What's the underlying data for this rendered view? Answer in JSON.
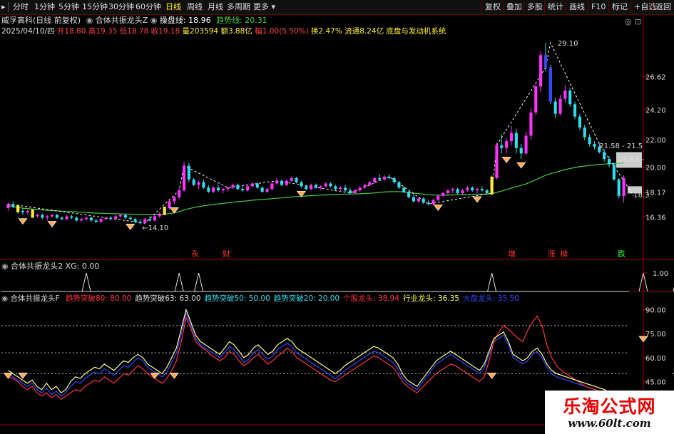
{
  "toolbar": {
    "tabs": [
      {
        "label": "分时",
        "active": false
      },
      {
        "label": "1分钟",
        "active": false
      },
      {
        "label": "5分钟",
        "active": false
      },
      {
        "label": "15分钟",
        "active": false
      },
      {
        "label": "30分钟",
        "active": false
      },
      {
        "label": "60分钟",
        "active": false
      },
      {
        "label": "日线",
        "active": true
      },
      {
        "label": "周线",
        "active": false
      },
      {
        "label": "月线",
        "active": false
      },
      {
        "label": "多周期",
        "active": false
      },
      {
        "label": "更多",
        "active": false
      }
    ],
    "right_buttons": [
      "复权",
      "叠加",
      "多股",
      "统计",
      "画线",
      "F10",
      "标记",
      "+自选",
      "返回"
    ]
  },
  "header": {
    "stock_title": "威孚高科(日线 前复权)",
    "indicator_name": "合体共振龙头Z",
    "caoban_label": "操盘线:",
    "caoban_value": "18.96",
    "trend_label": "趋势线:",
    "trend_value": "20.31",
    "quote": {
      "date": "2025/04/10/四",
      "open_label": "开",
      "open": "18.80",
      "high_label": "高",
      "high": "19.35",
      "low_label": "低",
      "low": "18.78",
      "close_label": "收",
      "close": "19.18",
      "vol_label": "量",
      "vol": "203594",
      "amount_label": "额",
      "amount": "3.88亿",
      "change_label": "幅",
      "change": "1.00(5.50%)",
      "turnover_label": "换",
      "turnover": "2.47%",
      "float_label": "流通",
      "float": "8.24亿",
      "sector": "底盘与发动机系统"
    }
  },
  "main_chart": {
    "price_axis": [
      "26.62",
      "24.20",
      "22.00",
      "20.00",
      "18.17",
      "16.36"
    ],
    "peak_label": "29.10",
    "low_label": "14.10",
    "right_labels": [
      "21.58 - 21.5",
      "20.58 -",
      "18.3"
    ],
    "bottom_tags": [
      {
        "text": "永",
        "color": "#ff3333"
      },
      {
        "text": "财",
        "color": "#ff3333"
      },
      {
        "text": "增",
        "color": "#ff3333"
      },
      {
        "text": "涨",
        "color": "#ff3333"
      },
      {
        "text": "榜",
        "color": "#ff3333"
      },
      {
        "text": "跌",
        "color": "#33ff33"
      }
    ],
    "colors": {
      "up": "#ff33ff",
      "down": "#33ddee",
      "ma": "#44cc44",
      "bg": "#000000",
      "grid": "#880000"
    },
    "candles": [
      [
        17.0,
        17.4,
        16.8,
        17.3
      ],
      [
        17.3,
        17.5,
        17.0,
        17.1
      ],
      [
        17.1,
        17.3,
        16.6,
        16.8
      ],
      [
        16.8,
        17.0,
        16.5,
        16.7
      ],
      [
        16.7,
        16.9,
        16.5,
        16.8
      ],
      [
        16.8,
        16.9,
        16.3,
        16.4
      ],
      [
        16.4,
        16.6,
        16.3,
        16.5
      ],
      [
        16.5,
        16.6,
        16.2,
        16.3
      ],
      [
        16.3,
        16.5,
        16.1,
        16.4
      ],
      [
        16.4,
        16.6,
        16.3,
        16.5
      ],
      [
        16.5,
        16.6,
        16.2,
        16.3
      ],
      [
        16.3,
        16.4,
        16.1,
        16.2
      ],
      [
        16.2,
        16.5,
        16.1,
        16.4
      ],
      [
        16.4,
        16.5,
        16.2,
        16.3
      ],
      [
        16.3,
        16.4,
        16.0,
        16.1
      ],
      [
        16.1,
        16.3,
        16.0,
        16.2
      ],
      [
        16.2,
        16.4,
        16.1,
        16.3
      ],
      [
        16.3,
        16.4,
        16.0,
        16.1
      ],
      [
        16.1,
        16.2,
        15.9,
        16.0
      ],
      [
        16.0,
        16.3,
        15.9,
        16.2
      ],
      [
        16.2,
        16.4,
        16.1,
        16.3
      ],
      [
        16.3,
        16.4,
        16.1,
        16.2
      ],
      [
        16.2,
        16.5,
        16.1,
        16.4
      ],
      [
        16.4,
        16.6,
        16.3,
        16.5
      ],
      [
        16.5,
        16.6,
        16.2,
        16.3
      ],
      [
        16.3,
        16.4,
        16.1,
        16.2
      ],
      [
        16.2,
        16.3,
        15.9,
        16.0
      ],
      [
        16.0,
        16.2,
        15.8,
        15.9
      ],
      [
        15.9,
        16.3,
        15.8,
        16.2
      ],
      [
        16.2,
        16.4,
        16.0,
        16.1
      ],
      [
        16.1,
        16.5,
        16.0,
        16.4
      ],
      [
        16.4,
        16.7,
        16.3,
        16.6
      ],
      [
        16.6,
        17.1,
        16.5,
        17.0
      ],
      [
        17.0,
        17.6,
        16.9,
        17.5
      ],
      [
        17.5,
        17.9,
        17.3,
        17.8
      ],
      [
        17.8,
        18.5,
        17.7,
        18.3
      ],
      [
        18.3,
        20.4,
        18.2,
        20.1
      ],
      [
        20.1,
        20.3,
        18.9,
        19.1
      ],
      [
        19.1,
        19.2,
        18.6,
        18.7
      ],
      [
        18.7,
        19.0,
        18.4,
        18.9
      ],
      [
        18.9,
        19.1,
        18.4,
        18.5
      ],
      [
        18.5,
        18.7,
        18.1,
        18.2
      ],
      [
        18.2,
        18.6,
        18.1,
        18.5
      ],
      [
        18.5,
        18.7,
        18.2,
        18.3
      ],
      [
        18.3,
        18.5,
        18.1,
        18.4
      ],
      [
        18.4,
        18.6,
        18.2,
        18.5
      ],
      [
        18.5,
        18.8,
        18.4,
        18.7
      ],
      [
        18.7,
        18.8,
        18.3,
        18.4
      ],
      [
        18.4,
        18.6,
        18.2,
        18.3
      ],
      [
        18.3,
        18.7,
        18.2,
        18.6
      ],
      [
        18.6,
        18.9,
        18.5,
        18.8
      ],
      [
        18.8,
        18.9,
        18.4,
        18.5
      ],
      [
        18.5,
        18.6,
        18.1,
        18.2
      ],
      [
        18.2,
        18.5,
        18.1,
        18.4
      ],
      [
        18.4,
        18.9,
        18.3,
        18.8
      ],
      [
        18.8,
        19.2,
        18.7,
        19.0
      ],
      [
        19.0,
        19.1,
        18.6,
        18.7
      ],
      [
        18.7,
        19.1,
        18.6,
        19.0
      ],
      [
        19.0,
        19.3,
        18.9,
        19.2
      ],
      [
        19.2,
        19.3,
        18.8,
        18.9
      ],
      [
        18.9,
        19.0,
        18.5,
        18.6
      ],
      [
        18.6,
        18.7,
        18.3,
        18.4
      ],
      [
        18.4,
        18.8,
        18.3,
        18.7
      ],
      [
        18.7,
        18.8,
        18.4,
        18.5
      ],
      [
        18.5,
        18.7,
        18.3,
        18.6
      ],
      [
        18.6,
        18.9,
        18.5,
        18.8
      ],
      [
        18.8,
        18.9,
        18.5,
        18.6
      ],
      [
        18.6,
        18.7,
        18.3,
        18.4
      ],
      [
        18.4,
        18.6,
        18.2,
        18.5
      ],
      [
        18.5,
        18.7,
        18.2,
        18.3
      ],
      [
        18.3,
        18.5,
        18.0,
        18.1
      ],
      [
        18.1,
        18.4,
        18.0,
        18.3
      ],
      [
        18.3,
        18.6,
        18.2,
        18.5
      ],
      [
        18.5,
        18.8,
        18.4,
        18.7
      ],
      [
        18.7,
        19.0,
        18.6,
        18.9
      ],
      [
        18.9,
        19.3,
        18.8,
        19.2
      ],
      [
        19.2,
        19.5,
        19.0,
        19.1
      ],
      [
        19.1,
        19.4,
        19.0,
        19.3
      ],
      [
        19.3,
        19.5,
        19.1,
        19.2
      ],
      [
        19.2,
        19.3,
        18.8,
        18.9
      ],
      [
        18.9,
        19.0,
        18.4,
        18.5
      ],
      [
        18.5,
        18.6,
        18.1,
        18.2
      ],
      [
        18.2,
        18.3,
        17.7,
        17.8
      ],
      [
        17.8,
        18.0,
        17.4,
        17.5
      ],
      [
        17.5,
        17.8,
        17.4,
        17.7
      ],
      [
        17.7,
        17.8,
        17.3,
        17.4
      ],
      [
        17.4,
        17.6,
        17.2,
        17.3
      ],
      [
        17.3,
        17.7,
        17.2,
        17.6
      ],
      [
        17.6,
        18.0,
        17.5,
        17.9
      ],
      [
        17.9,
        18.2,
        17.8,
        18.1
      ],
      [
        18.1,
        18.4,
        18.0,
        18.3
      ],
      [
        18.3,
        18.5,
        18.1,
        18.4
      ],
      [
        18.4,
        18.5,
        18.0,
        18.1
      ],
      [
        18.1,
        18.4,
        18.0,
        18.3
      ],
      [
        18.3,
        18.6,
        18.2,
        18.5
      ],
      [
        18.5,
        18.6,
        18.2,
        18.3
      ],
      [
        18.3,
        18.5,
        18.1,
        18.4
      ],
      [
        18.4,
        18.6,
        18.2,
        18.3
      ],
      [
        18.3,
        18.4,
        18.0,
        18.1
      ],
      [
        18.1,
        19.4,
        18.0,
        19.2
      ],
      [
        19.2,
        21.8,
        19.1,
        21.6
      ],
      [
        21.6,
        22.4,
        21.0,
        21.4
      ],
      [
        21.4,
        22.1,
        21.0,
        21.9
      ],
      [
        21.9,
        23.0,
        21.6,
        22.5
      ],
      [
        22.5,
        22.8,
        21.0,
        21.4
      ],
      [
        21.4,
        21.7,
        20.6,
        21.0
      ],
      [
        21.0,
        22.6,
        20.9,
        22.3
      ],
      [
        22.3,
        24.3,
        22.0,
        24.0
      ],
      [
        24.0,
        26.2,
        23.8,
        25.9
      ],
      [
        25.9,
        28.5,
        25.5,
        28.2
      ],
      [
        28.2,
        29.1,
        27.0,
        27.3
      ],
      [
        27.3,
        27.5,
        24.6,
        24.8
      ],
      [
        24.8,
        25.1,
        23.6,
        23.9
      ],
      [
        23.9,
        25.3,
        23.8,
        25.0
      ],
      [
        25.0,
        26.0,
        24.7,
        25.6
      ],
      [
        25.6,
        25.8,
        24.4,
        24.6
      ],
      [
        24.6,
        24.8,
        23.5,
        23.7
      ],
      [
        23.7,
        23.9,
        22.7,
        22.9
      ],
      [
        22.9,
        23.1,
        22.0,
        22.2
      ],
      [
        22.2,
        22.4,
        21.5,
        21.7
      ],
      [
        21.7,
        21.9,
        21.3,
        21.5
      ],
      [
        21.5,
        21.8,
        21.0,
        21.1
      ],
      [
        21.1,
        21.3,
        20.4,
        20.6
      ],
      [
        20.6,
        20.8,
        20.0,
        20.2
      ],
      [
        20.2,
        20.3,
        19.0,
        19.1
      ],
      [
        19.1,
        19.2,
        17.7,
        17.9
      ],
      [
        17.9,
        19.4,
        17.4,
        19.2
      ]
    ],
    "ma": [
      17.2,
      17.1,
      17.05,
      17.0,
      16.97,
      16.93,
      16.9,
      16.87,
      16.84,
      16.82,
      16.8,
      16.78,
      16.76,
      16.74,
      16.72,
      16.7,
      16.68,
      16.66,
      16.64,
      16.62,
      16.61,
      16.6,
      16.59,
      16.58,
      16.57,
      16.56,
      16.55,
      16.54,
      16.53,
      16.53,
      16.53,
      16.54,
      16.56,
      16.6,
      16.66,
      16.74,
      16.86,
      16.96,
      17.04,
      17.11,
      17.17,
      17.22,
      17.27,
      17.31,
      17.35,
      17.39,
      17.43,
      17.47,
      17.5,
      17.54,
      17.58,
      17.61,
      17.63,
      17.66,
      17.69,
      17.72,
      17.75,
      17.78,
      17.82,
      17.85,
      17.87,
      17.89,
      17.91,
      17.93,
      17.95,
      17.97,
      17.99,
      18.0,
      18.01,
      18.02,
      18.03,
      18.04,
      18.05,
      18.07,
      18.09,
      18.12,
      18.15,
      18.18,
      18.2,
      18.21,
      18.2,
      18.18,
      18.15,
      18.1,
      18.06,
      18.02,
      17.98,
      17.96,
      17.95,
      17.95,
      17.96,
      17.97,
      17.98,
      17.99,
      18.0,
      18.01,
      18.02,
      18.03,
      18.04,
      18.07,
      18.15,
      18.25,
      18.35,
      18.47,
      18.57,
      18.66,
      18.77,
      18.92,
      19.08,
      19.25,
      19.4,
      19.52,
      19.62,
      19.72,
      19.82,
      19.9,
      19.97,
      20.03,
      20.08,
      20.12,
      20.16,
      20.19,
      20.22,
      20.25,
      20.27,
      20.28,
      20.31
    ]
  },
  "sub1": {
    "title": "合体共振龙头2",
    "xg_label": "XG:",
    "xg_value": "0.00",
    "axis_value": "1.00",
    "spikes": [
      16,
      35,
      39,
      99,
      130,
      137,
      142
    ]
  },
  "sub2": {
    "title": "合体共振龙头F",
    "legend": [
      {
        "label": "趋势突破80:",
        "value": "80.00",
        "color": "#ff3344"
      },
      {
        "label": "趋势突破63:",
        "value": "63.00",
        "color": "#dddddd"
      },
      {
        "label": "趋势突破50:",
        "value": "50.00",
        "color": "#33ddee"
      },
      {
        "label": "趋势突破20:",
        "value": "20.00",
        "color": "#33ddee"
      },
      {
        "label": "个股龙头:",
        "value": "38.94",
        "color": "#ff3344"
      },
      {
        "label": "行业龙头:",
        "value": "36.35",
        "color": "#ffff55"
      },
      {
        "label": "大盘龙头:",
        "value": "35.50",
        "color": "#3344ff"
      }
    ],
    "axis": [
      "90.00",
      "75.00",
      "60.00",
      "45.00"
    ],
    "series_red": [
      48,
      47,
      45,
      42,
      40,
      42,
      38,
      36,
      38,
      35,
      37,
      34,
      36,
      38,
      40,
      39,
      42,
      44,
      46,
      45,
      48,
      46,
      44,
      47,
      50,
      49,
      52,
      55,
      53,
      50,
      48,
      46,
      44,
      47,
      52,
      58,
      70,
      85,
      78,
      70,
      67,
      65,
      62,
      60,
      58,
      60,
      64,
      62,
      58,
      55,
      57,
      60,
      62,
      59,
      56,
      58,
      61,
      63,
      66,
      64,
      60,
      58,
      56,
      54,
      52,
      50,
      48,
      46,
      45,
      47,
      49,
      51,
      53,
      55,
      57,
      59,
      61,
      60,
      58,
      56,
      54,
      50,
      45,
      42,
      40,
      38,
      41,
      44,
      47,
      50,
      52,
      54,
      56,
      55,
      53,
      51,
      49,
      47,
      45,
      48,
      58,
      70,
      76,
      80,
      78,
      75,
      72,
      70,
      77,
      82,
      86,
      80,
      68,
      60,
      55,
      52,
      50,
      48,
      46,
      44,
      42,
      41,
      40,
      39,
      38,
      37,
      36,
      38,
      39
    ],
    "series_yellow": [
      52,
      50,
      48,
      46,
      44,
      46,
      42,
      40,
      44,
      40,
      42,
      38,
      40,
      45,
      48,
      47,
      50,
      52,
      54,
      53,
      56,
      54,
      52,
      55,
      58,
      57,
      60,
      62,
      60,
      56,
      54,
      52,
      50,
      54,
      60,
      66,
      78,
      90,
      82,
      74,
      70,
      68,
      66,
      64,
      62,
      66,
      70,
      68,
      64,
      60,
      62,
      66,
      68,
      65,
      62,
      64,
      68,
      70,
      72,
      70,
      66,
      64,
      62,
      60,
      58,
      56,
      54,
      52,
      50,
      52,
      55,
      57,
      59,
      61,
      63,
      65,
      67,
      66,
      64,
      62,
      60,
      56,
      50,
      46,
      44,
      42,
      46,
      50,
      54,
      58,
      60,
      62,
      64,
      62,
      60,
      58,
      56,
      54,
      52,
      56,
      64,
      72,
      74,
      76,
      70,
      62,
      60,
      58,
      60,
      64,
      66,
      62,
      56,
      52,
      50,
      49,
      48,
      47,
      46,
      45,
      44,
      43,
      42,
      41,
      40,
      38,
      37,
      36,
      36
    ],
    "series_blue": [
      50,
      48,
      46,
      44,
      42,
      44,
      40,
      38,
      41,
      37,
      39,
      36,
      38,
      42,
      45,
      44,
      47,
      49,
      51,
      50,
      53,
      51,
      49,
      52,
      55,
      54,
      57,
      60,
      58,
      54,
      52,
      50,
      48,
      51,
      57,
      63,
      75,
      88,
      80,
      72,
      68,
      66,
      64,
      62,
      60,
      63,
      67,
      65,
      61,
      57,
      59,
      63,
      65,
      62,
      59,
      61,
      65,
      67,
      69,
      67,
      63,
      61,
      59,
      57,
      55,
      53,
      51,
      49,
      47,
      49,
      52,
      54,
      56,
      58,
      60,
      62,
      64,
      63,
      61,
      59,
      57,
      53,
      47,
      44,
      42,
      40,
      44,
      48,
      52,
      56,
      58,
      60,
      62,
      60,
      58,
      56,
      54,
      52,
      50,
      54,
      62,
      70,
      72,
      74,
      68,
      60,
      58,
      56,
      58,
      62,
      64,
      60,
      54,
      50,
      48,
      47,
      46,
      45,
      44,
      43,
      42,
      41,
      40,
      39,
      38,
      36,
      35,
      35,
      35
    ]
  },
  "watermark": {
    "line1": "乐淘公式网",
    "line2": "www.60lt.com"
  }
}
